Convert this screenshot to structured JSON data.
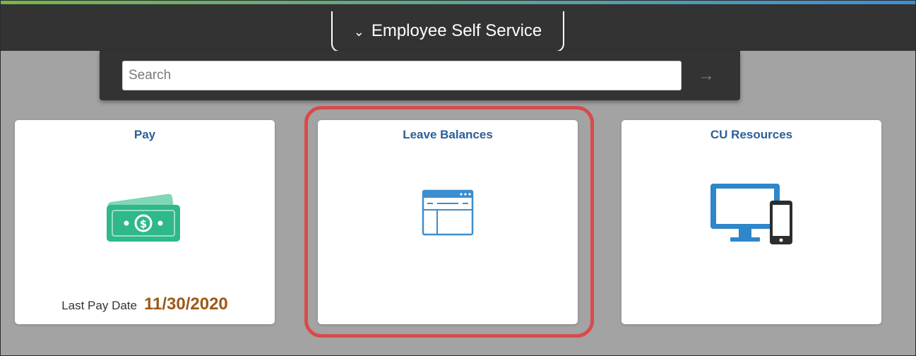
{
  "header": {
    "homepage_title": "Employee Self Service"
  },
  "search": {
    "placeholder": "Search"
  },
  "tiles": [
    {
      "title": "Pay",
      "icon": "cash-icon",
      "footer_label": "Last Pay Date",
      "footer_value": "11/30/2020"
    },
    {
      "title": "Leave Balances",
      "icon": "browser-window-icon",
      "highlighted": true
    },
    {
      "title": "CU Resources",
      "icon": "desktop-phone-icon"
    }
  ],
  "colors": {
    "header_bg": "#333333",
    "page_bg": "#a3a3a3",
    "tile_title": "#2b5f96",
    "pay_date": "#9b5a17",
    "highlight": "#d94b4b",
    "pay_icon": "#2fb88a",
    "leave_icon": "#3b8ed0",
    "resources_icon": "#2f86c9"
  }
}
